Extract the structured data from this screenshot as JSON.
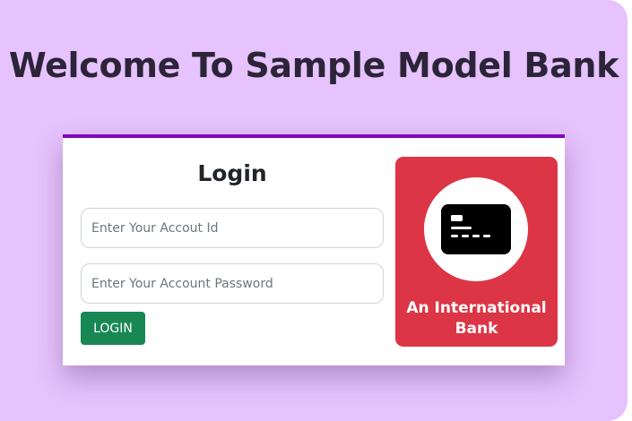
{
  "page": {
    "heading": "Welcome To Sample Model Bank",
    "background_color": "#e6c3fd"
  },
  "login_card": {
    "accent_color": "#7e06c2",
    "title": "Login",
    "account_id_field": {
      "placeholder": "Enter Your Accout Id",
      "value": ""
    },
    "password_field": {
      "placeholder": "Enter Your Account Password",
      "value": ""
    },
    "login_button": {
      "label": "LOGIN",
      "color": "#198754"
    }
  },
  "promo_panel": {
    "color": "#dc3545",
    "icon": "credit-card-icon",
    "text": "An International Bank"
  }
}
